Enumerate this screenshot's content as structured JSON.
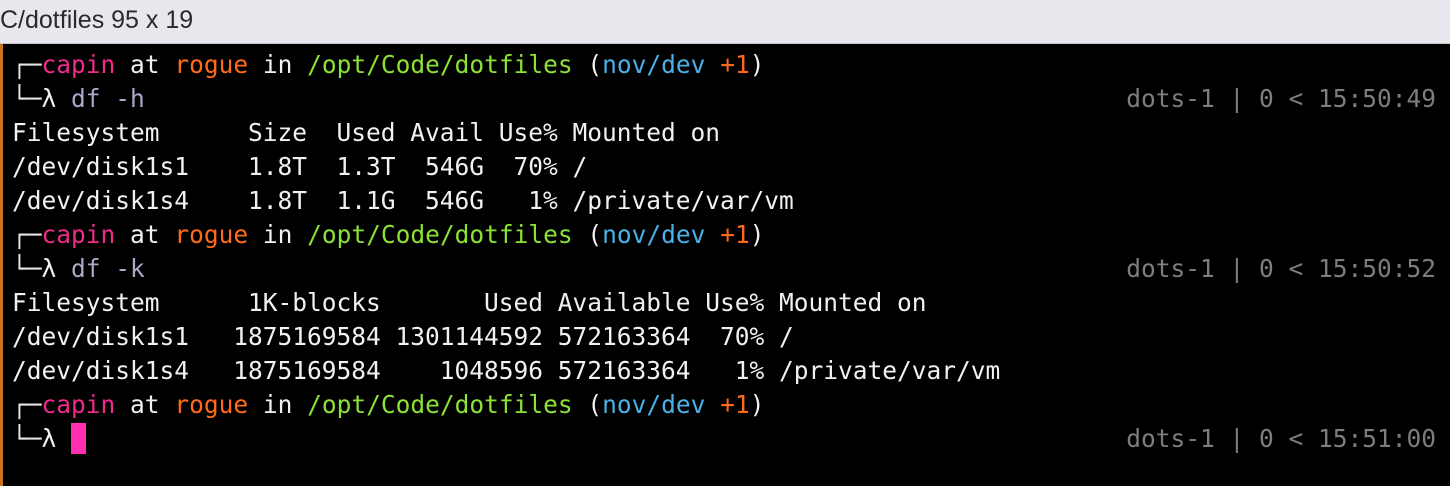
{
  "window": {
    "title": "C/dotfiles 95 x 19"
  },
  "prompt": {
    "user": "capin",
    "at": "at",
    "host": "rogue",
    "in": "in",
    "path": "/opt/Code/dotfiles",
    "branch": "nov/dev",
    "dirty": "+1",
    "lambda": "λ"
  },
  "blocks": [
    {
      "command": "df -h",
      "right_status": "dots-1 | 0 < 15:50:49",
      "output": [
        "Filesystem      Size  Used Avail Use% Mounted on",
        "/dev/disk1s1    1.8T  1.3T  546G  70% /",
        "/dev/disk1s4    1.8T  1.1G  546G   1% /private/var/vm"
      ]
    },
    {
      "command": "df -k",
      "right_status": "dots-1 | 0 < 15:50:52",
      "output": [
        "Filesystem      1K-blocks       Used Available Use% Mounted on",
        "/dev/disk1s1   1875169584 1301144592 572163364  70% /",
        "/dev/disk1s4   1875169584    1048596 572163364   1% /private/var/vm"
      ]
    },
    {
      "command": "",
      "right_status": "dots-1 | 0 < 15:51:00",
      "output": []
    }
  ],
  "colors": {
    "user": "#f02a8c",
    "host": "#ff6a1a",
    "path": "#8ce135",
    "branch": "#4cb0e8",
    "cursor": "#ff2fb0",
    "left_rule": "#c8731f"
  }
}
